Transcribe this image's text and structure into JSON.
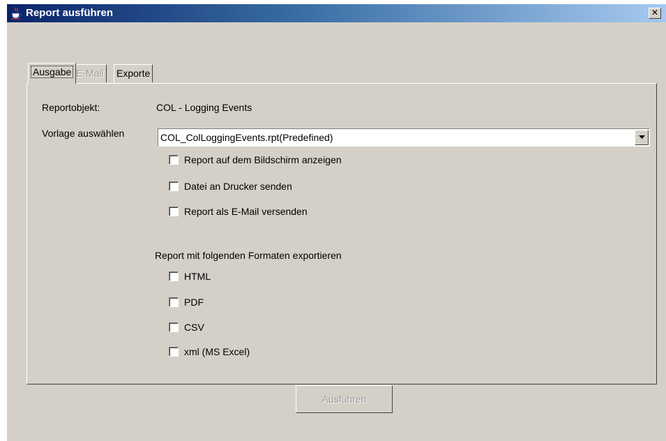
{
  "window": {
    "title": "Report ausführen",
    "icon": "java-coffee-cup-icon",
    "close_icon": "close-icon",
    "close_glyph": "✕"
  },
  "tabs": [
    {
      "label": "Ausgabe",
      "state": "selected"
    },
    {
      "label": "E-Mail",
      "state": "disabled"
    },
    {
      "label": "Exporte",
      "state": "normal"
    }
  ],
  "form": {
    "report_object_label": "Reportobjekt:",
    "report_object_value": "COL - Logging Events",
    "template_label": "Vorlage auswählen",
    "template_value": "COL_ColLoggingEvents.rpt(Predefined)"
  },
  "output_options": [
    {
      "label": "Report auf dem Bildschirm anzeigen",
      "checked": false
    },
    {
      "label": "Datei an Drucker senden",
      "checked": false
    },
    {
      "label": "Report als E-Mail versenden",
      "checked": false
    }
  ],
  "export": {
    "heading": "Report mit folgenden Formaten exportieren",
    "formats": [
      {
        "label": "HTML",
        "checked": false
      },
      {
        "label": "PDF",
        "checked": false
      },
      {
        "label": "CSV",
        "checked": false
      },
      {
        "label": "xml (MS Excel)",
        "checked": false
      }
    ]
  },
  "actions": {
    "run_label": "Ausführen",
    "run_enabled": false
  },
  "colors": {
    "titlebar_start": "#0a246a",
    "titlebar_end": "#a6caf0",
    "window_face": "#d4d0c8",
    "disabled_text": "#9a9a9a"
  }
}
